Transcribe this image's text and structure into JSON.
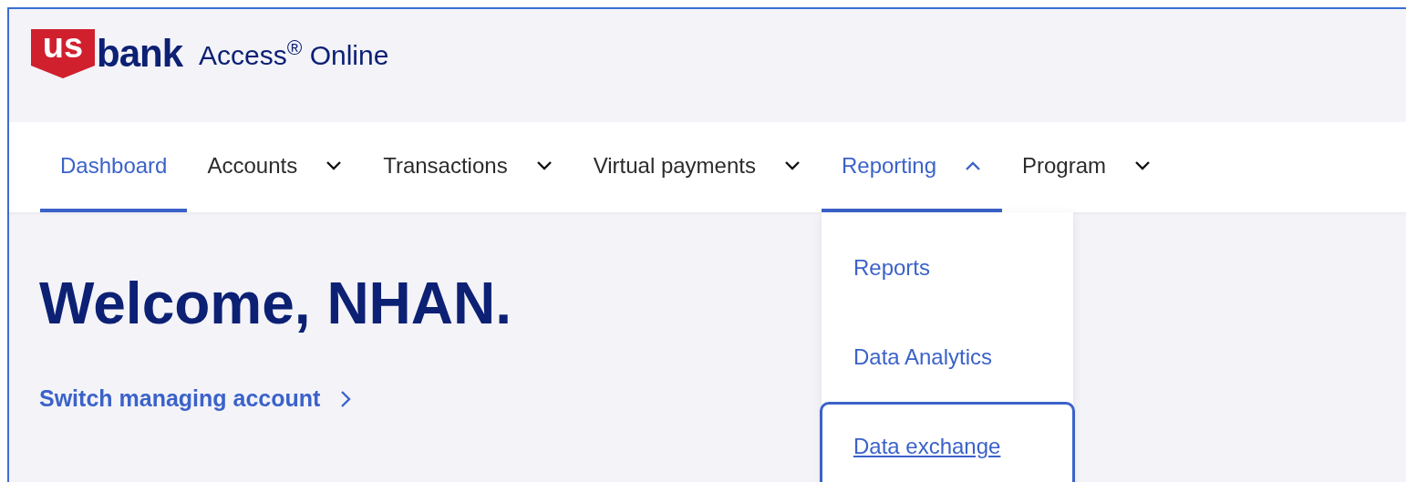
{
  "header": {
    "logo_mark": "us",
    "logo_word": "bank",
    "product": "Access$^{®}$ Online"
  },
  "nav": [
    {
      "label": "Dashboard",
      "kind": "link",
      "selected": true
    },
    {
      "label": "Accounts",
      "kind": "menu",
      "selected": false,
      "expanded": false
    },
    {
      "label": "Transactions",
      "kind": "menu",
      "selected": false,
      "expanded": false
    },
    {
      "label": "Virtual payments",
      "kind": "menu",
      "selected": false,
      "expanded": false
    },
    {
      "label": "Reporting",
      "kind": "menu",
      "selected": true,
      "expanded": true,
      "menu": [
        {
          "label": "Reports",
          "focused": false
        },
        {
          "label": "Data Analytics",
          "focused": false
        },
        {
          "label": "Data exchange",
          "focused": true
        }
      ]
    },
    {
      "label": "Program",
      "kind": "menu",
      "selected": false,
      "expanded": false
    }
  ],
  "welcome": "Welcome, NHAN.",
  "switch_link": "Switch managing account"
}
